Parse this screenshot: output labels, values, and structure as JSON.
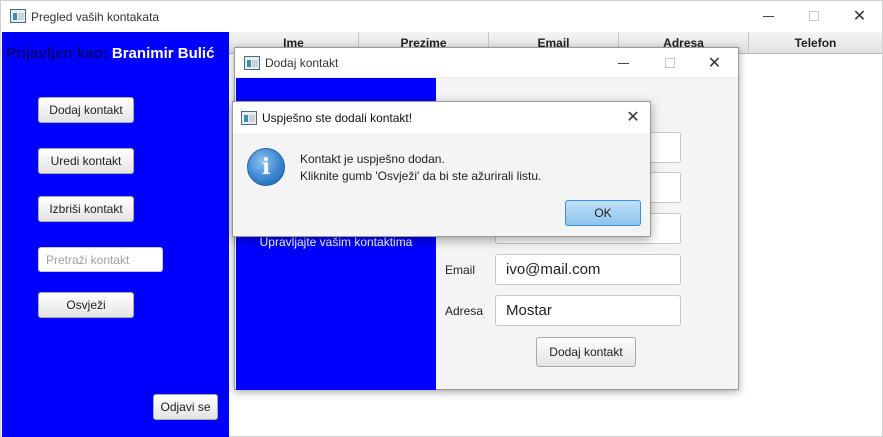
{
  "main_window": {
    "title": "Pregled vaših kontakata",
    "logged_prefix": "Prijavljen kao:",
    "logged_user": "Branimir Bulić",
    "buttons": {
      "add": "Dodaj kontakt",
      "edit": "Uredi kontakt",
      "delete": "Izbriši kontakt",
      "refresh": "Osvježi",
      "logout": "Odjavi se"
    },
    "search_placeholder": "Pretraži kontakt",
    "table_columns": [
      "Ime",
      "Prezime",
      "Email",
      "Adresa",
      "Telefon"
    ]
  },
  "add_dialog": {
    "title": "Dodaj kontakt",
    "subtitle": "Upravljajte vašim kontaktima",
    "fields": {
      "email_label": "Email",
      "email_value": "ivo@mail.com",
      "address_label": "Adresa",
      "address_value": "Mostar"
    },
    "submit_label": "Dodaj kontakt"
  },
  "alert": {
    "title": "Uspješno ste dodali kontakt!",
    "line1": "Kontakt je uspješno dodan.",
    "line2": "Kliknite gumb 'Osvježi' da bi ste ažurirali listu.",
    "ok_label": "OK",
    "icon": "info-icon"
  },
  "colors": {
    "sidebar_blue": "#0000ff",
    "ok_button": "#8ec4ec"
  }
}
